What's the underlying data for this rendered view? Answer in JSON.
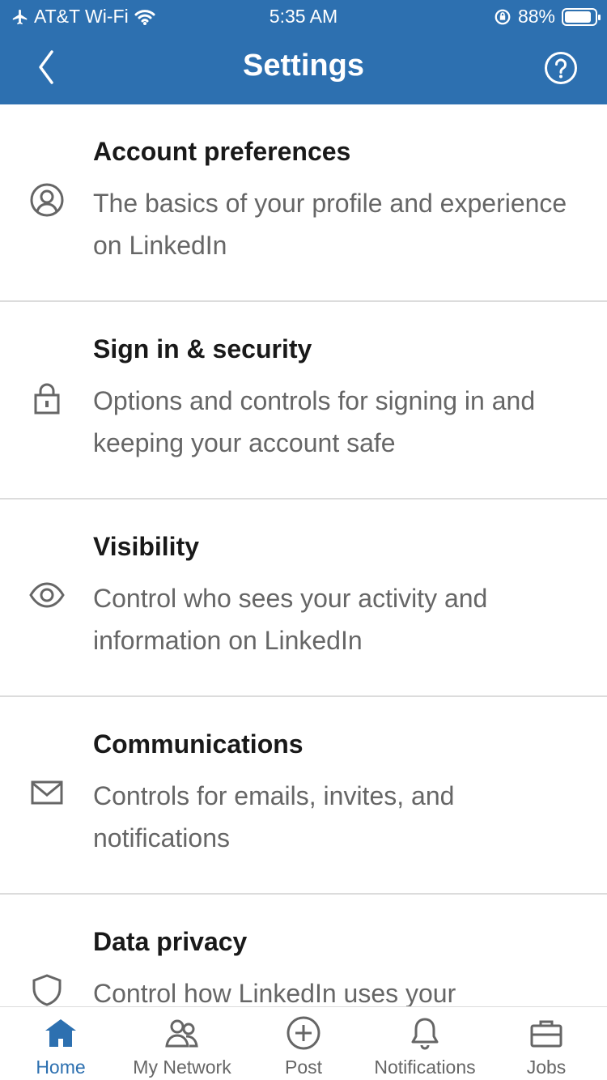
{
  "status_bar": {
    "carrier": "AT&T Wi-Fi",
    "time": "5:35 AM",
    "battery": "88%",
    "battery_level": 0.88
  },
  "header": {
    "title": "Settings",
    "back_icon": "chevron-left-icon",
    "help_icon": "question-circle-icon"
  },
  "settings": {
    "items": [
      {
        "title": "Account preferences",
        "description": "The basics of your profile and experience on LinkedIn",
        "icon": "person-circle-icon"
      },
      {
        "title": "Sign in & security",
        "description": "Options and controls for signing in and keeping your account safe",
        "icon": "lock-icon"
      },
      {
        "title": "Visibility",
        "description": "Control who sees your activity and information on LinkedIn",
        "icon": "eye-icon"
      },
      {
        "title": "Communications",
        "description": "Controls for emails, invites, and notifications",
        "icon": "envelope-icon"
      },
      {
        "title": "Data privacy",
        "description": "Control how LinkedIn uses your",
        "icon": "shield-icon"
      }
    ]
  },
  "tabbar": {
    "tabs": [
      {
        "label": "Home",
        "icon": "home-icon",
        "active": true
      },
      {
        "label": "My Network",
        "icon": "people-icon",
        "active": false
      },
      {
        "label": "Post",
        "icon": "plus-circle-icon",
        "active": false
      },
      {
        "label": "Notifications",
        "icon": "bell-icon",
        "active": false
      },
      {
        "label": "Jobs",
        "icon": "briefcase-icon",
        "active": false
      }
    ]
  },
  "colors": {
    "brand_blue": "#2d70b0",
    "text_primary": "#191919",
    "text_secondary": "#666666",
    "divider": "#dcdcdc"
  }
}
